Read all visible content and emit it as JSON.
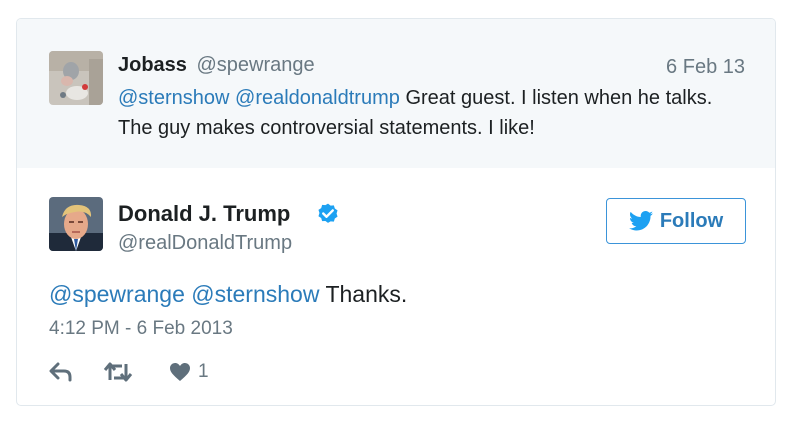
{
  "parent_tweet": {
    "author_name": "Jobass",
    "author_handle": "@spewrange",
    "date": "6 Feb 13",
    "mention_1": "@sternshow",
    "mention_2": "@realdonaldtrump",
    "text": "Great guest. I listen when he talks. The guy makes controversial statements. I like!"
  },
  "main_tweet": {
    "author_name": "Donald J. Trump",
    "author_handle": "@realDonaldTrump",
    "verified_icon": "verified-badge-icon",
    "follow_label": "Follow",
    "mention_1": "@spewrange",
    "mention_2": "@sternshow",
    "text": "Thanks.",
    "timestamp": "4:12 PM - 6 Feb 2013"
  },
  "actions": {
    "reply_icon": "reply-icon",
    "retweet_icon": "retweet-icon",
    "like_icon": "heart-icon",
    "like_count": "1"
  },
  "colors": {
    "link_blue": "#2b7bb9",
    "verified_blue": "#1da1f2",
    "muted_gray": "#697882",
    "parent_bg": "#f5f8fa",
    "border": "#e1e8ed"
  }
}
